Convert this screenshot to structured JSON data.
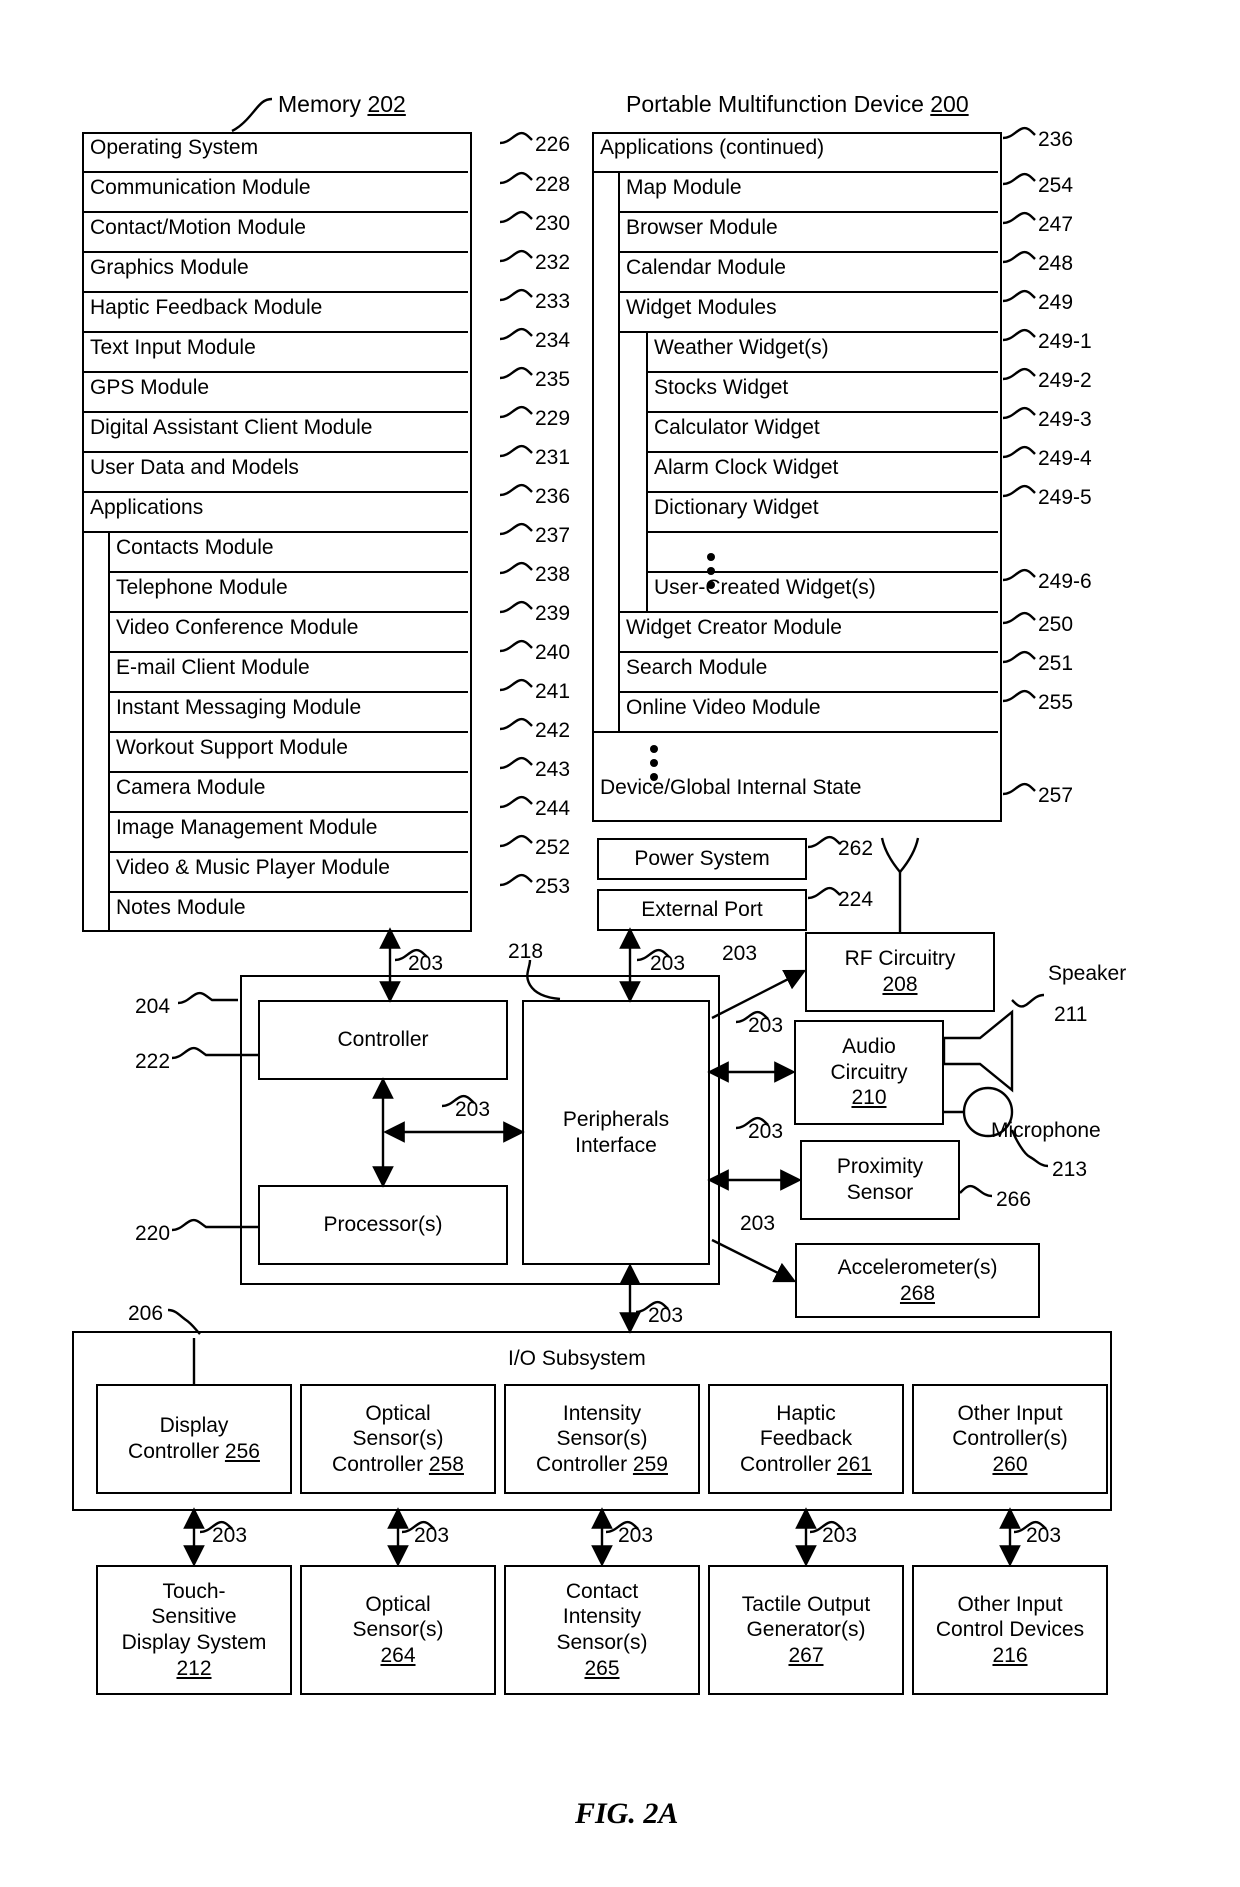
{
  "figure": {
    "caption": "FIG. 2A"
  },
  "memory": {
    "title": "Memory",
    "ref": "202",
    "rows": [
      {
        "label": "Operating System",
        "ref": "226",
        "indent": 0
      },
      {
        "label": "Communication Module",
        "ref": "228",
        "indent": 0
      },
      {
        "label": "Contact/Motion Module",
        "ref": "230",
        "indent": 0
      },
      {
        "label": "Graphics Module",
        "ref": "232",
        "indent": 0
      },
      {
        "label": "Haptic Feedback Module",
        "ref": "233",
        "indent": 0
      },
      {
        "label": "Text Input Module",
        "ref": "234",
        "indent": 0
      },
      {
        "label": "GPS Module",
        "ref": "235",
        "indent": 0
      },
      {
        "label": "Digital Assistant Client Module",
        "ref": "229",
        "indent": 0
      },
      {
        "label": "User Data and Models",
        "ref": "231",
        "indent": 0
      },
      {
        "label": "Applications",
        "ref": "236",
        "indent": 0
      },
      {
        "label": "Contacts Module",
        "ref": "237",
        "indent": 1
      },
      {
        "label": "Telephone Module",
        "ref": "238",
        "indent": 1
      },
      {
        "label": "Video Conference Module",
        "ref": "239",
        "indent": 1
      },
      {
        "label": "E-mail Client Module",
        "ref": "240",
        "indent": 1
      },
      {
        "label": "Instant Messaging Module",
        "ref": "241",
        "indent": 1
      },
      {
        "label": "Workout Support Module",
        "ref": "242",
        "indent": 1
      },
      {
        "label": "Camera Module",
        "ref": "243",
        "indent": 1
      },
      {
        "label": "Image Management Module",
        "ref": "244",
        "indent": 1
      },
      {
        "label": "Video & Music Player Module",
        "ref": "252",
        "indent": 1
      },
      {
        "label": "Notes Module",
        "ref": "253",
        "indent": 1
      }
    ]
  },
  "device": {
    "title": "Portable Multifunction Device",
    "ref": "200",
    "rows": [
      {
        "label": "Applications (continued)",
        "ref": "236",
        "indent": 0
      },
      {
        "label": "Map Module",
        "ref": "254",
        "indent": 1
      },
      {
        "label": "Browser Module",
        "ref": "247",
        "indent": 1
      },
      {
        "label": "Calendar Module",
        "ref": "248",
        "indent": 1
      },
      {
        "label": "Widget Modules",
        "ref": "249",
        "indent": 1
      },
      {
        "label": "Weather Widget(s)",
        "ref": "249-1",
        "indent": 2
      },
      {
        "label": "Stocks Widget",
        "ref": "249-2",
        "indent": 2
      },
      {
        "label": "Calculator Widget",
        "ref": "249-3",
        "indent": 2
      },
      {
        "label": "Alarm Clock Widget",
        "ref": "249-4",
        "indent": 2
      },
      {
        "label": "Dictionary Widget",
        "ref": "249-5",
        "indent": 2
      },
      {
        "label": "User-Created Widget(s)",
        "ref": "249-6",
        "indent": 2
      },
      {
        "label": "Widget Creator Module",
        "ref": "250",
        "indent": 1
      },
      {
        "label": "Search Module",
        "ref": "251",
        "indent": 1
      },
      {
        "label": "Online Video Module",
        "ref": "255",
        "indent": 1
      },
      {
        "label": "Device/Global Internal State",
        "ref": "257",
        "indent": 0
      }
    ]
  },
  "power": {
    "label": "Power System",
    "ref": "262"
  },
  "external_port": {
    "label": "External Port",
    "ref": "224"
  },
  "rf": {
    "label": "RF Circuitry",
    "ref": "208"
  },
  "audio": {
    "label_line1": "Audio",
    "label_line2": "Circuitry",
    "ref": "210"
  },
  "proximity": {
    "label_line1": "Proximity",
    "label_line2": "Sensor",
    "ref": "266"
  },
  "accelerometer": {
    "label": "Accelerometer(s)",
    "ref": "268"
  },
  "speaker": {
    "label": "Speaker",
    "ref": "211"
  },
  "microphone": {
    "label": "Microphone",
    "ref": "213"
  },
  "controller": {
    "label": "Controller",
    "ref": "222"
  },
  "processor": {
    "label": "Processor(s)",
    "ref": "220"
  },
  "peripherals": {
    "label_line1": "Peripherals",
    "label_line2": "Interface",
    "ref": "218"
  },
  "cpu_group_ref": "204",
  "io_subsystem": {
    "label": "I/O Subsystem",
    "ref": "206",
    "controllers": [
      {
        "line1": "Display",
        "line2": "Controller",
        "ref": "256"
      },
      {
        "line1": "Optical",
        "line2": "Sensor(s)",
        "line3": "Controller",
        "ref": "258"
      },
      {
        "line1": "Intensity",
        "line2": "Sensor(s)",
        "line3": "Controller",
        "ref": "259"
      },
      {
        "line1": "Haptic",
        "line2": "Feedback",
        "line3": "Controller",
        "ref": "261"
      },
      {
        "line1": "Other Input",
        "line2": "Controller(s)",
        "ref": "260"
      }
    ],
    "devices": [
      {
        "line1": "Touch-",
        "line2": "Sensitive",
        "line3": "Display System",
        "ref": "212"
      },
      {
        "line1": "Optical",
        "line2": "Sensor(s)",
        "ref": "264"
      },
      {
        "line1": "Contact",
        "line2": "Intensity",
        "line3": "Sensor(s)",
        "ref": "265"
      },
      {
        "line1": "Tactile Output",
        "line2": "Generator(s)",
        "ref": "267"
      },
      {
        "line1": "Other Input",
        "line2": "Control Devices",
        "ref": "216"
      }
    ]
  },
  "bus_label": "203",
  "bus_labels": [
    "203",
    "203",
    "203",
    "203",
    "203",
    "203",
    "203",
    "203",
    "203",
    "203",
    "203",
    "203",
    "203",
    "203",
    "203",
    "203",
    "203"
  ]
}
